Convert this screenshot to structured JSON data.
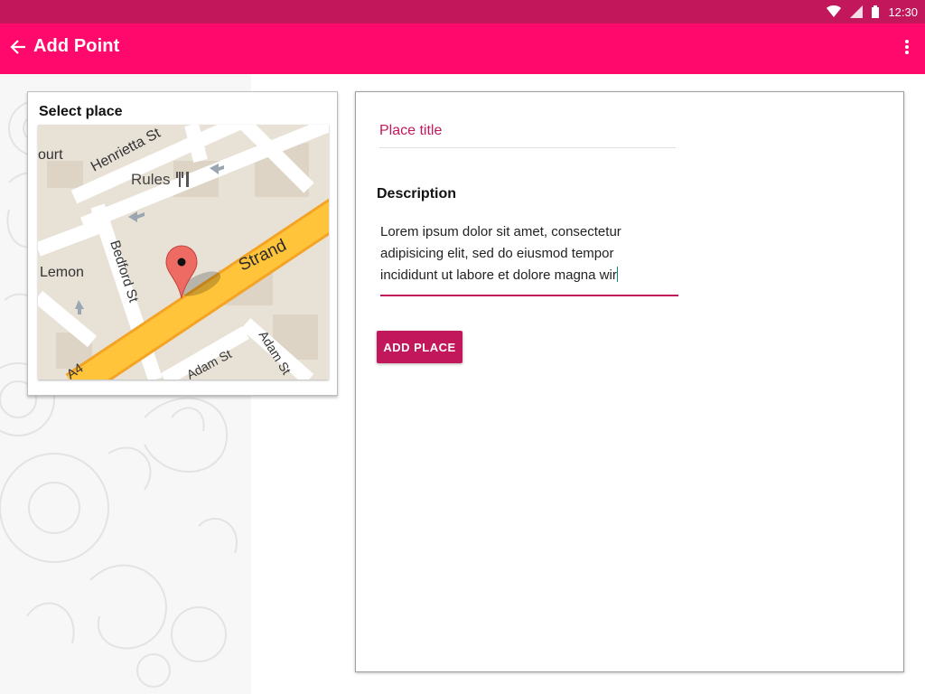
{
  "status_bar": {
    "time": "12:30",
    "icons": [
      "wifi-icon",
      "signal-icon",
      "battery-icon"
    ],
    "color": "#c2185b"
  },
  "app_bar": {
    "title": "Add Point",
    "back_icon": "arrow-left-icon",
    "menu_icon": "more-vert-icon",
    "color": "#ff0a6c"
  },
  "map_card": {
    "title": "Select place",
    "map_labels": {
      "street_1": "Henrietta St",
      "place_1": "Rules",
      "street_2": "Bedford St",
      "street_3": "Strand",
      "street_4": "Adam St",
      "street_5": "Adam St",
      "place_2": "Lemon",
      "fragment_1": "ourt",
      "fragment_2": "A4"
    },
    "pin_icon": "map-pin-icon",
    "restaurant_icon": "restaurant-icon"
  },
  "form": {
    "title_placeholder": "Place title",
    "description_label": "Description",
    "description_value": "Lorem ipsum dolor sit amet, consectetur adipisicing elit, sed do eiusmod tempor incididunt ut labore et dolore magna wir",
    "submit_label": "ADD PLACE",
    "accent": "#c2185b"
  }
}
